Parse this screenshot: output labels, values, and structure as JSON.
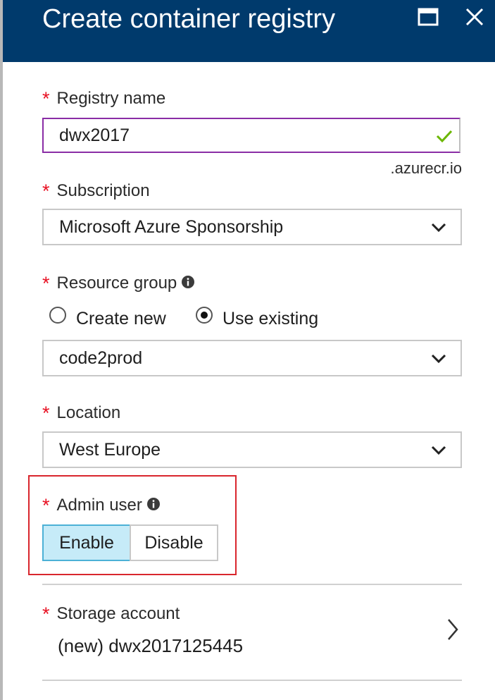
{
  "header": {
    "title": "Create container registry"
  },
  "registry_name": {
    "label": "Registry name",
    "value": "dwx2017",
    "suffix": ".azurecr.io"
  },
  "subscription": {
    "label": "Subscription",
    "value": "Microsoft Azure Sponsorship"
  },
  "resource_group": {
    "label": "Resource group",
    "options": [
      "Create new",
      "Use existing"
    ],
    "selected_option": "Use existing",
    "value": "code2prod"
  },
  "location": {
    "label": "Location",
    "value": "West Europe"
  },
  "admin_user": {
    "label": "Admin user",
    "enable_label": "Enable",
    "disable_label": "Disable",
    "selected": "Enable"
  },
  "storage_account": {
    "label": "Storage account",
    "value": "(new) dwx2017125445"
  },
  "colors": {
    "header_bg": "#003a6c",
    "required_star": "#e81123",
    "valid_check": "#6bb700",
    "active_input_border": "#8a2da5",
    "selected_toggle_bg": "#c6ebf8",
    "highlight_box": "#d9262d"
  }
}
